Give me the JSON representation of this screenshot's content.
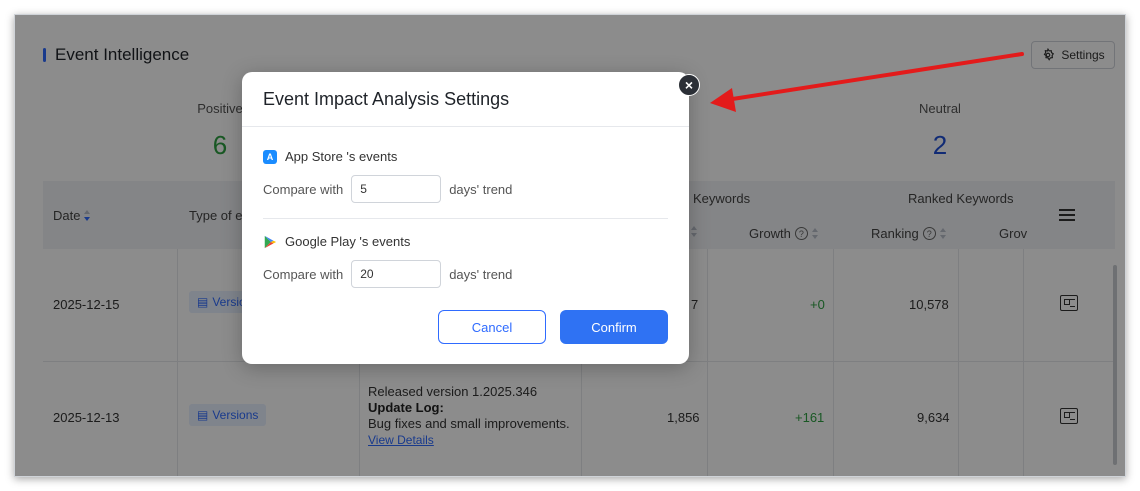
{
  "section": {
    "title": "Event Intelligence",
    "settings_label": "Settings"
  },
  "stats": {
    "positive": {
      "label": "Positive",
      "value": "6"
    },
    "neutral": {
      "label": "Neutral",
      "value": "2"
    }
  },
  "table": {
    "headers": {
      "date": "Date",
      "type": "Type of e",
      "keywords": "Keywords",
      "ranked_keywords": "Ranked Keywords",
      "growth": "Growth",
      "ranking": "Ranking",
      "growth2": "Grov"
    },
    "rows": [
      {
        "date": "2025-12-15",
        "type": "Versio",
        "value1": "7",
        "growth": "+0",
        "ranking": "10,578"
      },
      {
        "date": "2025-12-13",
        "type": "Versions",
        "released": "Released version 1.2025.346",
        "update_log_label": "Update Log:",
        "update_log": "Bug fixes and small improvements.",
        "view_details": "View Details",
        "value1": "1,856",
        "growth": "+161",
        "ranking": "9,634"
      }
    ]
  },
  "modal": {
    "title": "Event Impact Analysis Settings",
    "close": "×",
    "app_store": {
      "label": "App Store 's events",
      "compare_with": "Compare with",
      "value": "5",
      "suffix": "days' trend"
    },
    "google_play": {
      "label": "Google Play 's events",
      "compare_with": "Compare with",
      "value": "20",
      "suffix": "days' trend"
    },
    "cancel": "Cancel",
    "confirm": "Confirm"
  },
  "colors": {
    "accent": "#2f72f3",
    "positive": "#2ea043",
    "neutral": "#1f4fd6",
    "annotation_arrow": "#e31b1b"
  },
  "icons": [
    "settings-gear-icon",
    "sort-icon",
    "help-icon",
    "document-icon",
    "card-icon",
    "menu-icon",
    "app-store-icon",
    "google-play-icon",
    "close-icon"
  ]
}
